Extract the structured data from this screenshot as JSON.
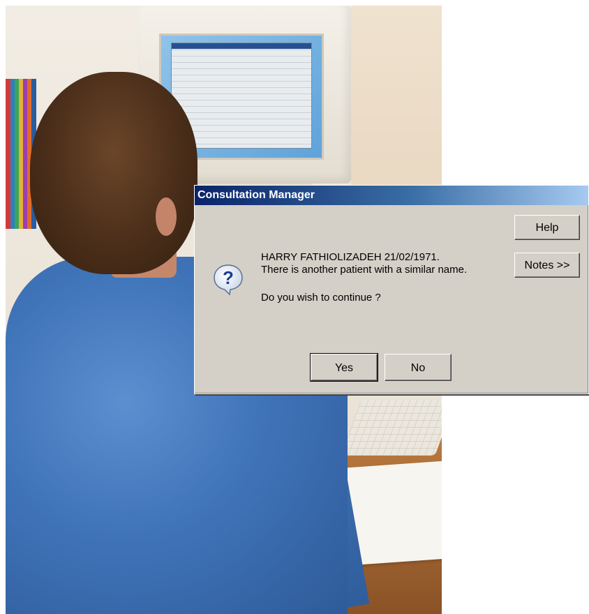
{
  "dialog": {
    "title": "Consultation Manager",
    "icon": "question-icon",
    "message": {
      "line1": "HARRY FATHIOLIZADEH 21/02/1971.",
      "line2": "There is another patient with a similar name.",
      "line3": "Do you wish to continue ?"
    },
    "buttons": {
      "help": "Help",
      "notes": "Notes >>",
      "yes": "Yes",
      "no": "No"
    }
  },
  "colors": {
    "titlebar_start": "#0a246a",
    "titlebar_end": "#a6caf0",
    "dialog_face": "#d4d0c8",
    "shirt": "#3f73b8"
  }
}
